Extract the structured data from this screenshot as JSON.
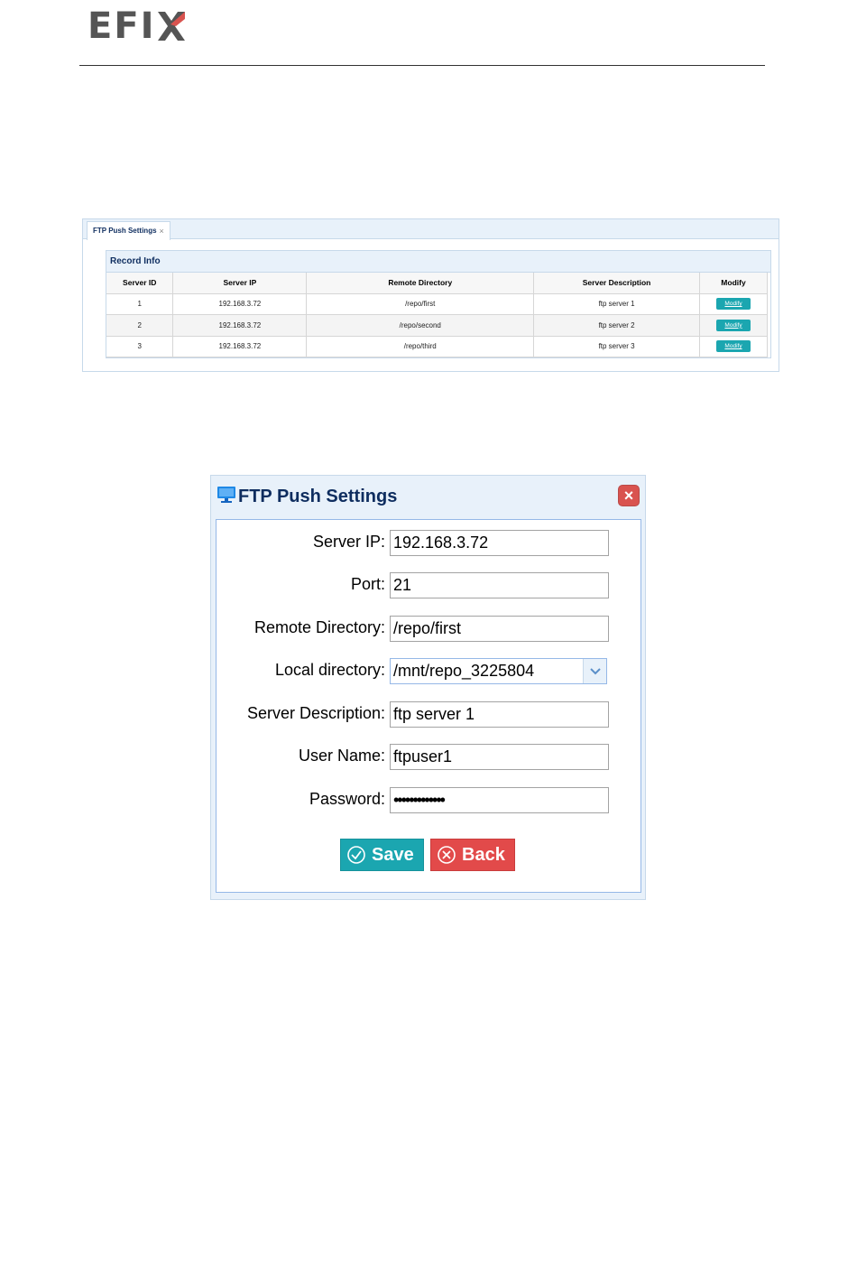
{
  "header": {
    "logo_text": "EFI",
    "logo_accent_color": "#d9534f"
  },
  "record_panel": {
    "tab_label": "FTP Push Settings",
    "tab_close": "×",
    "section_title": "Record Info",
    "columns": [
      "Server ID",
      "Server IP",
      "Remote Directory",
      "Server Description",
      "Modify"
    ],
    "rows": [
      {
        "id": "1",
        "ip": "192.168.3.72",
        "dir": "/repo/first",
        "desc": "ftp server 1",
        "action": "Modify"
      },
      {
        "id": "2",
        "ip": "192.168.3.72",
        "dir": "/repo/second",
        "desc": "ftp server 2",
        "action": "Modify"
      },
      {
        "id": "3",
        "ip": "192.168.3.72",
        "dir": "/repo/third",
        "desc": "ftp server 3",
        "action": "Modify"
      }
    ]
  },
  "dialog": {
    "title": "FTP Push Settings",
    "title_icon": "monitor-icon",
    "close_icon": "close-icon",
    "fields": {
      "server_ip": {
        "label": "Server IP:",
        "value": "192.168.3.72"
      },
      "port": {
        "label": "Port:",
        "value": "21"
      },
      "remote_directory": {
        "label": "Remote Directory:",
        "value": "/repo/first"
      },
      "local_directory": {
        "label": "Local directory:",
        "value": "/mnt/repo_3225804"
      },
      "server_description": {
        "label": "Server Description:",
        "value": "ftp server 1"
      },
      "user_name": {
        "label": "User Name:",
        "value": "ftpuser1"
      },
      "password": {
        "label": "Password:",
        "value": "•••••••••••••"
      }
    },
    "save_label": "Save",
    "back_label": "Back",
    "save_color": "#1ba6b0",
    "back_color": "#e24a4a"
  }
}
